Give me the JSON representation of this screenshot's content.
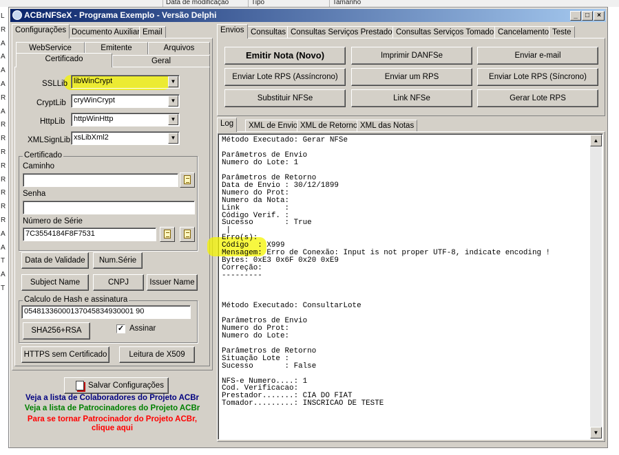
{
  "background": {
    "columns": [
      "Data de modificação",
      "Tipo",
      "Tamanho"
    ],
    "left_letters": [
      "L",
      "R",
      "A",
      "A",
      "A",
      "A",
      "R",
      "A",
      "R",
      "R",
      "R",
      "R",
      "R",
      "R",
      "R",
      "R",
      "A",
      "A",
      "T",
      "A",
      "T"
    ]
  },
  "window": {
    "title": "ACBrNFSeX - Programa Exemplo - Versão Delphi",
    "controls": {
      "minimize": "_",
      "maximize": "□",
      "close": "×"
    }
  },
  "left": {
    "top_tabs": [
      "Configurações",
      "Documento Auxiliar",
      "Email"
    ],
    "sub_tabs_row1": [
      "WebService",
      "Emitente",
      "Arquivos"
    ],
    "sub_tabs_row2": [
      "Certificado",
      "Geral"
    ],
    "ssllib": {
      "label": "SSLLib",
      "value": "libWinCrypt"
    },
    "cryptlib": {
      "label": "CryptLib",
      "value": "cryWinCrypt"
    },
    "httplib": {
      "label": "HttpLib",
      "value": "httpWinHttp"
    },
    "xmlsignlib": {
      "label": "XMLSignLib",
      "value": "xsLibXml2"
    },
    "certificado": {
      "group_label": "Certificado",
      "caminho_label": "Caminho",
      "caminho_value": "",
      "senha_label": "Senha",
      "senha_value": "",
      "serie_label": "Número de Série",
      "serie_value": "7C3554184F8F7531"
    },
    "buttons": {
      "data_validade": "Data de Validade",
      "num_serie": "Num.Série",
      "subject_name": "Subject Name",
      "cnpj": "CNPJ",
      "issuer_name": "Issuer Name"
    },
    "hash": {
      "group_label": "Calculo de Hash e assinatura",
      "value": "05481336000137045834930001 90",
      "sha_button": "SHA256+RSA",
      "assinar_label": "Assinar",
      "assinar_checked": "✓"
    },
    "https_button": "HTTPS sem Certificado",
    "x509_button": "Leitura de X509",
    "salvar_button": "Salvar Configurações",
    "links": {
      "colaboradores": "Veja a lista de Colaboradores do Projeto ACBr",
      "patrocinadores": "Veja a lista de Patrocinadores do Projeto ACBr",
      "patrocinador_line1": "Para se tornar Patrocinador do Projeto ACBr,",
      "patrocinador_line2": "clique aqui"
    },
    "colors": {
      "link_blue": "#000080",
      "link_green": "#008000",
      "link_red": "#ff0000",
      "highlight": "#f4f400"
    }
  },
  "right": {
    "top_tabs": [
      "Envios",
      "Consultas",
      "Consultas Serviços Prestados",
      "Consultas Serviços Tomados",
      "Cancelamento",
      "Teste"
    ],
    "action_buttons": [
      [
        "Emitir Nota (Novo)",
        "Imprimir DANFSe",
        "Enviar e-mail"
      ],
      [
        "Enviar Lote RPS (Assíncrono)",
        "Enviar um RPS",
        "Enviar Lote RPS (Síncrono)"
      ],
      [
        "Substituir NFSe",
        "Link NFSe",
        "Gerar Lote RPS"
      ]
    ],
    "log_tabs": [
      "Log",
      "XML de Envio",
      "XML de Retorno",
      "XML das Notas"
    ],
    "log_lines": [
      "Método Executado: Gerar NFSe",
      "",
      "Parâmetros de Envio",
      "Numero do Lote: 1",
      "",
      "Parâmetros de Retorno",
      "Data de Envio : 30/12/1899",
      "Numero do Prot:",
      "Numero da Nota:",
      "Link          :",
      "Código Verif. :",
      "Sucesso       : True",
      " |",
      "Erro(s):",
      "Código  : X999",
      "Mensagem: Erro de Conexão: Input is not proper UTF-8, indicate encoding !",
      "Bytes: 0xE3 0x6F 0x20 0xE9",
      "Correção:",
      "---------",
      "",
      "",
      "",
      "Método Executado: ConsultarLote",
      "",
      "Parâmetros de Envio",
      "Numero do Prot:",
      "Numero do Lote:",
      "",
      "Parâmetros de Retorno",
      "Situação Lote :",
      "Sucesso       : False",
      "",
      "NFS-e Numero....: 1",
      "Cod. Verificacao:",
      "Prestador.......: CIA DO FIAT",
      "Tomador.........: INSCRICAO DE TESTE"
    ]
  }
}
